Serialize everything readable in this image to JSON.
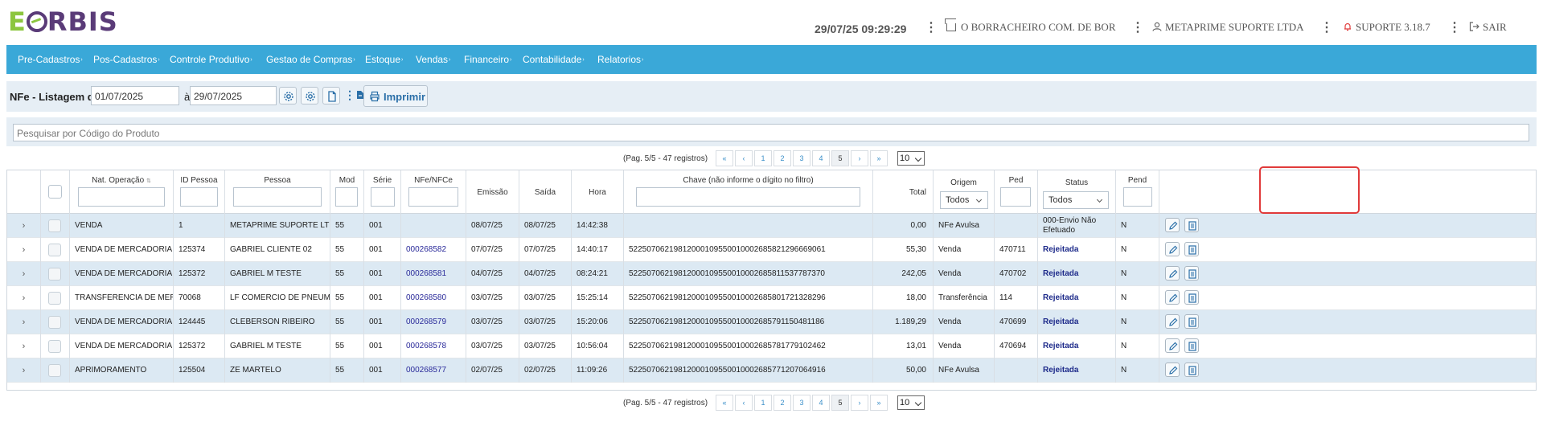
{
  "header": {
    "logo_text": "EORBIS",
    "datetime": "29/07/25 09:29:29",
    "company": "O BORRACHEIRO COM. DE BOR",
    "user": "METAPRIME SUPORTE LTDA",
    "version": "SUPORTE 3.18.7",
    "logout": "SAIR"
  },
  "nav": [
    {
      "label": "Pre-Cadastros"
    },
    {
      "label": "Pos-Cadastros"
    },
    {
      "label": "Controle Produtivo"
    },
    {
      "label": "Gestao de Compras"
    },
    {
      "label": "Estoque"
    },
    {
      "label": "Vendas"
    },
    {
      "label": "Financeiro"
    },
    {
      "label": "Contabilidade"
    },
    {
      "label": "Relatorios"
    }
  ],
  "toolbar": {
    "title": "NFe - Listagem de",
    "date_from": "01/07/2025",
    "date_to_label": "à",
    "date_to": "29/07/2025",
    "print_label": "Imprimir"
  },
  "search": {
    "placeholder": "Pesquisar por Código do Produto"
  },
  "pager": {
    "info": "(Pag. 5/5 - 47 registros)",
    "pages": [
      "1",
      "2",
      "3",
      "4",
      "5"
    ],
    "first": "«",
    "prev": "‹",
    "next": "›",
    "last": "»",
    "page_size": "10"
  },
  "columns": {
    "nat_operacao": "Nat. Operação",
    "sort_indicator": "⇅",
    "id_pessoa": "ID Pessoa",
    "pessoa": "Pessoa",
    "mod": "Mod",
    "serie": "Série",
    "nfe": "NFe/NFCe",
    "emissao": "Emissão",
    "saida": "Saída",
    "hora": "Hora",
    "chave": "Chave (não informe o dígito no filtro)",
    "total": "Total",
    "origem": "Origem",
    "origem_filter": "Todos",
    "ped": "Ped",
    "status": "Status",
    "status_filter": "Todos",
    "pend": "Pend"
  },
  "rows": [
    {
      "nat": "VENDA",
      "id": "1",
      "pessoa": "METAPRIME SUPORTE LTDA",
      "mod": "55",
      "serie": "001",
      "nfe": "",
      "emissao": "08/07/25",
      "saida": "08/07/25",
      "hora": "14:42:38",
      "chave": "",
      "total": "0,00",
      "origem": "NFe Avulsa",
      "ped": "",
      "status": "000-Envio Não Efetuado",
      "pend": "N"
    },
    {
      "nat": "VENDA DE MERCADORIA",
      "id": "125374",
      "pessoa": "GABRIEL CLIENTE 02",
      "mod": "55",
      "serie": "001",
      "nfe": "000268582",
      "emissao": "07/07/25",
      "saida": "07/07/25",
      "hora": "14:40:17",
      "chave": "52250706219812000109550010002685821296669061",
      "total": "55,30",
      "origem": "Venda",
      "ped": "470711",
      "status": "Rejeitada",
      "pend": "N"
    },
    {
      "nat": "VENDA DE MERCADORIA",
      "id": "125372",
      "pessoa": "GABRIEL M TESTE",
      "mod": "55",
      "serie": "001",
      "nfe": "000268581",
      "emissao": "04/07/25",
      "saida": "04/07/25",
      "hora": "08:24:21",
      "chave": "52250706219812000109550010002685811537787370",
      "total": "242,05",
      "origem": "Venda",
      "ped": "470702",
      "status": "Rejeitada",
      "pend": "N"
    },
    {
      "nat": "TRANSFERENCIA DE MERCAD...",
      "id": "70068",
      "pessoa": "LF COMERCIO DE PNEUMATI...",
      "mod": "55",
      "serie": "001",
      "nfe": "000268580",
      "emissao": "03/07/25",
      "saida": "03/07/25",
      "hora": "15:25:14",
      "chave": "52250706219812000109550010002685801721328296",
      "total": "18,00",
      "origem": "Transferência",
      "ped": "114",
      "status": "Rejeitada",
      "pend": "N"
    },
    {
      "nat": "VENDA DE MERCADORIA",
      "id": "124445",
      "pessoa": "CLEBERSON RIBEIRO",
      "mod": "55",
      "serie": "001",
      "nfe": "000268579",
      "emissao": "03/07/25",
      "saida": "03/07/25",
      "hora": "15:20:06",
      "chave": "52250706219812000109550010002685791150481186",
      "total": "1.189,29",
      "origem": "Venda",
      "ped": "470699",
      "status": "Rejeitada",
      "pend": "N"
    },
    {
      "nat": "VENDA DE MERCADORIA",
      "id": "125372",
      "pessoa": "GABRIEL M TESTE",
      "mod": "55",
      "serie": "001",
      "nfe": "000268578",
      "emissao": "03/07/25",
      "saida": "03/07/25",
      "hora": "10:56:04",
      "chave": "52250706219812000109550010002685781779102462",
      "total": "13,01",
      "origem": "Venda",
      "ped": "470694",
      "status": "Rejeitada",
      "pend": "N"
    },
    {
      "nat": "APRIMORAMENTO",
      "id": "125504",
      "pessoa": "ZE MARTELO",
      "mod": "55",
      "serie": "001",
      "nfe": "000268577",
      "emissao": "02/07/25",
      "saida": "02/07/25",
      "hora": "11:09:26",
      "chave": "52250706219812000109550010002685771207064916",
      "total": "50,00",
      "origem": "NFe Avulsa",
      "ped": "",
      "status": "Rejeitada",
      "pend": "N"
    }
  ],
  "colors": {
    "nav": "#3aa8d8",
    "row_alt": "#dce9f3",
    "status": "#1d2a8a",
    "highlight": "#e03a3a"
  }
}
